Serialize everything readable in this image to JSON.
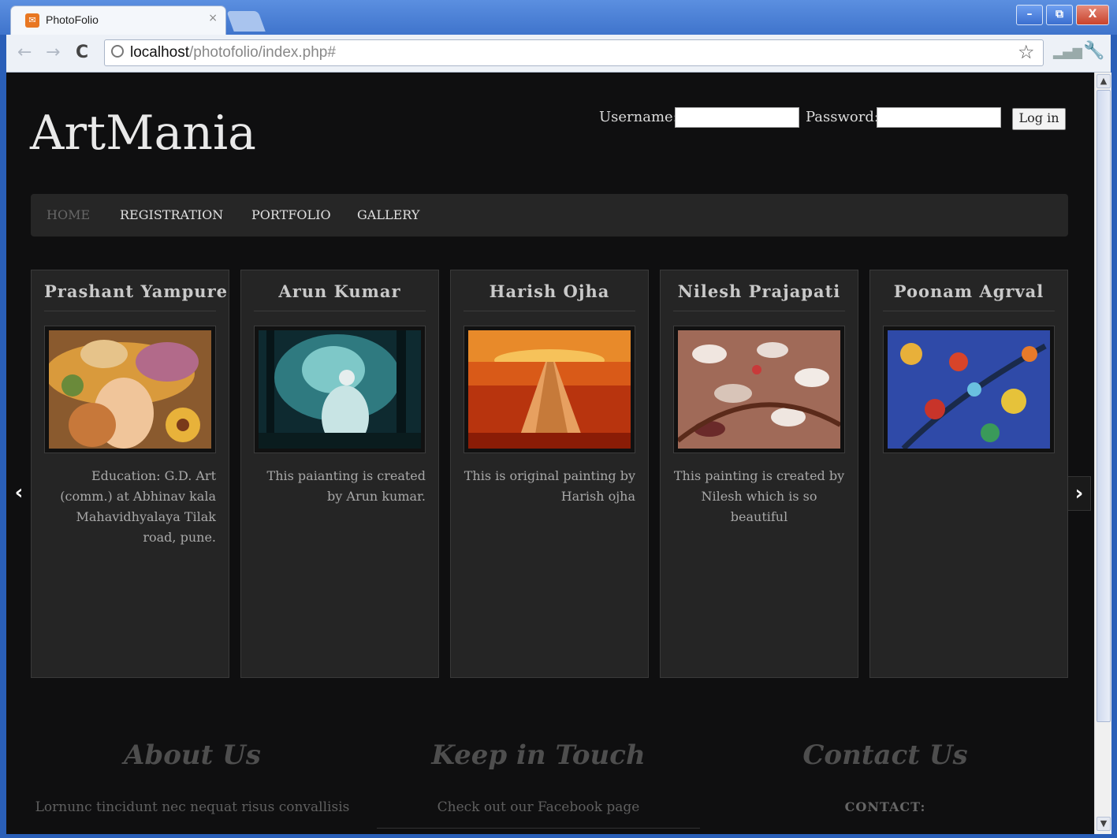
{
  "browser": {
    "tab_title": "PhotoFolio",
    "tab_close": "×",
    "url_host": "localhost",
    "url_path": "/photofolio/index.php#",
    "back": "←",
    "forward": "→",
    "reload": "C",
    "star": "☆",
    "wrench": "🔧",
    "bars": "▂▄▆",
    "minimize": "–",
    "restore": "⧉",
    "close": "X",
    "scroll_up": "▲",
    "scroll_down": "▼"
  },
  "header": {
    "logo": "ArtMania",
    "username_label": "Username:",
    "password_label": "Password:",
    "login_button": "Log in"
  },
  "menu": [
    "HOME",
    "REGISTRATION",
    "PORTFOLIO",
    "GALLERY"
  ],
  "carousel": {
    "prev": "‹",
    "next": "›",
    "cards": [
      {
        "title": "Prashant Yampure",
        "desc": "Education: G.D. Art (comm.) at Abhinav kala Mahavidhyalaya Tilak road, pune."
      },
      {
        "title": "Arun Kumar",
        "desc": "This paianting is created by Arun kumar."
      },
      {
        "title": "Harish Ojha",
        "desc": "This is original painting by Harish ojha"
      },
      {
        "title": "Nilesh Prajapati",
        "desc": "This painting is created by Nilesh which is so beautiful"
      },
      {
        "title": "Poonam Agrval",
        "desc": ""
      }
    ]
  },
  "footer": {
    "about_title": "About Us",
    "about_text": "Lornunc tincidunt nec nequat risus convallisis",
    "touch_title": "Keep in Touch",
    "touch_text": "Check out our Facebook page",
    "contact_title": "Contact Us",
    "contact_label": "CONTACT:"
  }
}
